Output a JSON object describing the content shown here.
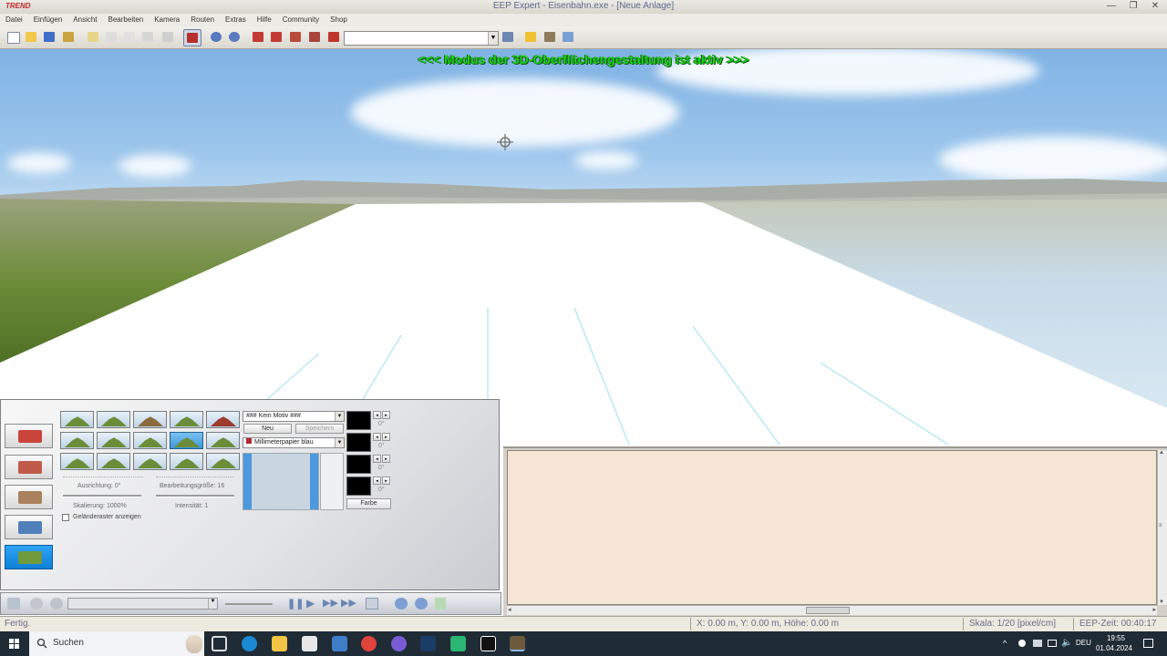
{
  "window": {
    "logo": "TREND",
    "title": "EEP Expert - Eisenbahn.exe - [Neue Anlage]",
    "controls": [
      "—",
      "❐",
      "✕"
    ]
  },
  "menu": [
    "Datei",
    "Einfügen",
    "Ansicht",
    "Bearbeiten",
    "Kamera",
    "Routen",
    "Extras",
    "Hilfe",
    "Community",
    "Shop"
  ],
  "toolbar": {
    "combo_value": "",
    "combo_arrow": "▼"
  },
  "viewport": {
    "mode_banner": "<<<  Modus der 3D-Oberflächengestaltung ist aktiv  >>>"
  },
  "tool_panel": {
    "motif_select": "### Kein Motiv ###",
    "new_button": "Neu",
    "save_button": "Speichern",
    "texture_select": "Millimeterpapier blau",
    "orientation_label": "Ausrichtung: 0°",
    "scale_label": "Skalierung: 1000%",
    "edit_size_label": "Bearbeitungsgröße: 16",
    "intensity_label": "Intensität: 1",
    "grid_checkbox_label": "Geländeraster anzeigen",
    "color_button": "Farbe",
    "degree_labels": [
      "0°",
      "0°",
      "0°",
      "0°"
    ],
    "combo_arrow": "▼"
  },
  "statusbar": {
    "status": "Fertig.",
    "coords": "X: 0.00 m, Y: 0.00 m, Höhe: 0.00 m",
    "scale": "Skala: 1/20 [pixel/cm]",
    "eep_time": "EEP-Zeit: 00:40:17"
  },
  "taskbar": {
    "search_placeholder": "Suchen",
    "language": "DEU",
    "time": "19:55",
    "date": "01.04.2024"
  },
  "colors": {
    "banner_green": "#1fd11f",
    "beige_panel": "#f6e4d4",
    "active_blue": "#1a8fe6"
  }
}
